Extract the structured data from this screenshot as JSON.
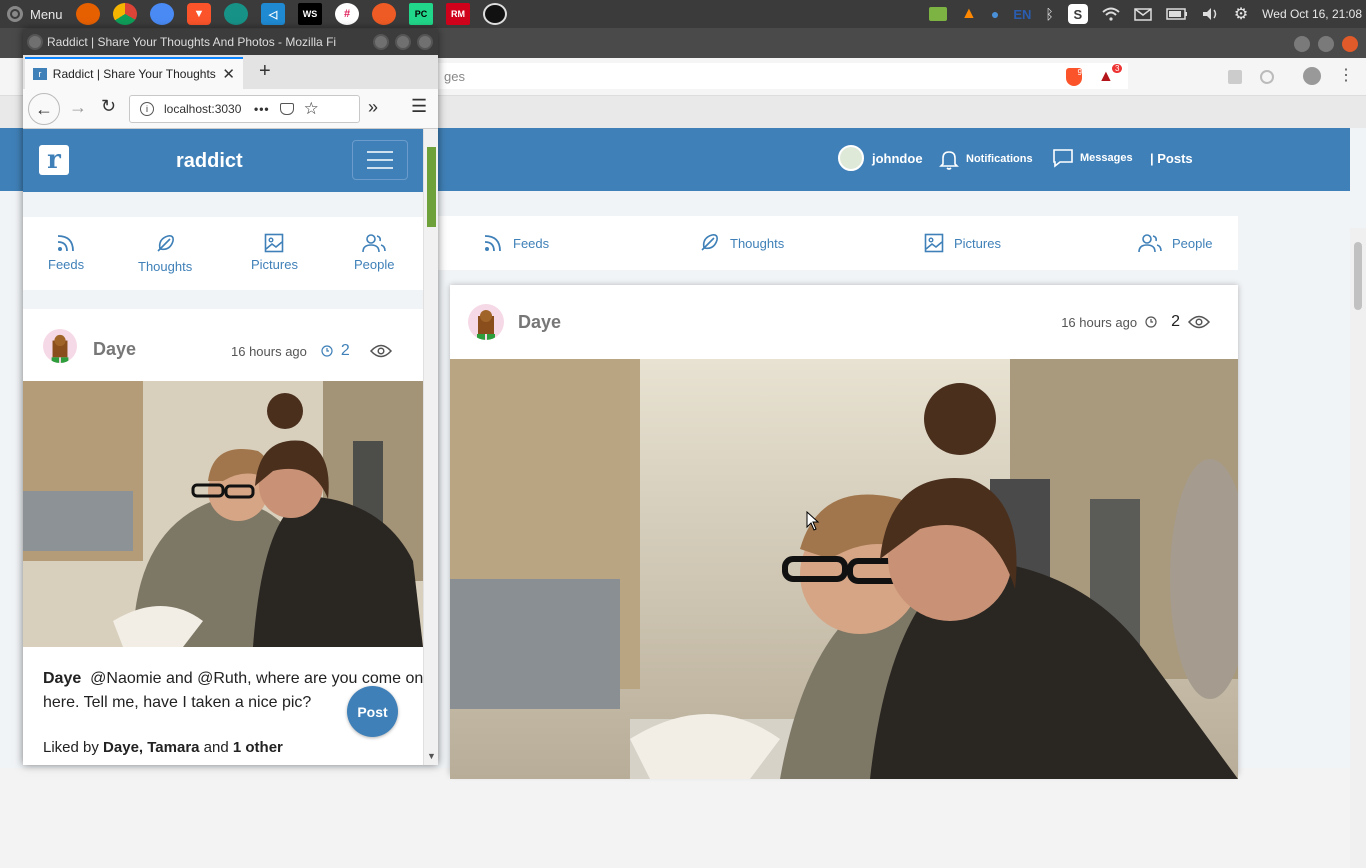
{
  "system": {
    "menu_label": "Menu",
    "lang": "EN",
    "datetime": "Wed Oct 16, 21:08",
    "launcher": [
      "firefox",
      "chrome",
      "chromium",
      "brave",
      "gitkraken",
      "vscode",
      "webstorm",
      "slack",
      "postman",
      "pycharm",
      "rubymine",
      "obs"
    ]
  },
  "firefox": {
    "window_title": "Raddict | Share Your Thoughts And Photos - Mozilla Fi",
    "tab_title": "Raddict | Share Your Thoughts",
    "url": "localhost:3030"
  },
  "brave": {
    "url_fragment": "ges",
    "badges": {
      "shield": "9",
      "rewards": "3"
    }
  },
  "app": {
    "brand": "raddict",
    "logo_letter": "r",
    "header": {
      "username": "johndoe",
      "notifications": "Notifications",
      "messages": "Messages",
      "posts": "| Posts"
    },
    "tabs": [
      {
        "label": "Feeds",
        "icon": "rss-icon"
      },
      {
        "label": "Thoughts",
        "icon": "feather-icon"
      },
      {
        "label": "Pictures",
        "icon": "image-icon"
      },
      {
        "label": "People",
        "icon": "users-icon"
      }
    ],
    "post": {
      "author": "Daye",
      "time": "16 hours ago",
      "views": "2",
      "caption_author": "Daye",
      "caption_text": "@Naomie and @Ruth, where are you come on here. Tell me, have I taken a nice pic?",
      "liked_prefix": "Liked by",
      "liked_names": "Daye, Tamara",
      "liked_and": "and",
      "liked_other": "1 other"
    },
    "post_button": "Post"
  },
  "colors": {
    "brand_blue": "#3f80b8",
    "panel": "#3b3b3b"
  }
}
